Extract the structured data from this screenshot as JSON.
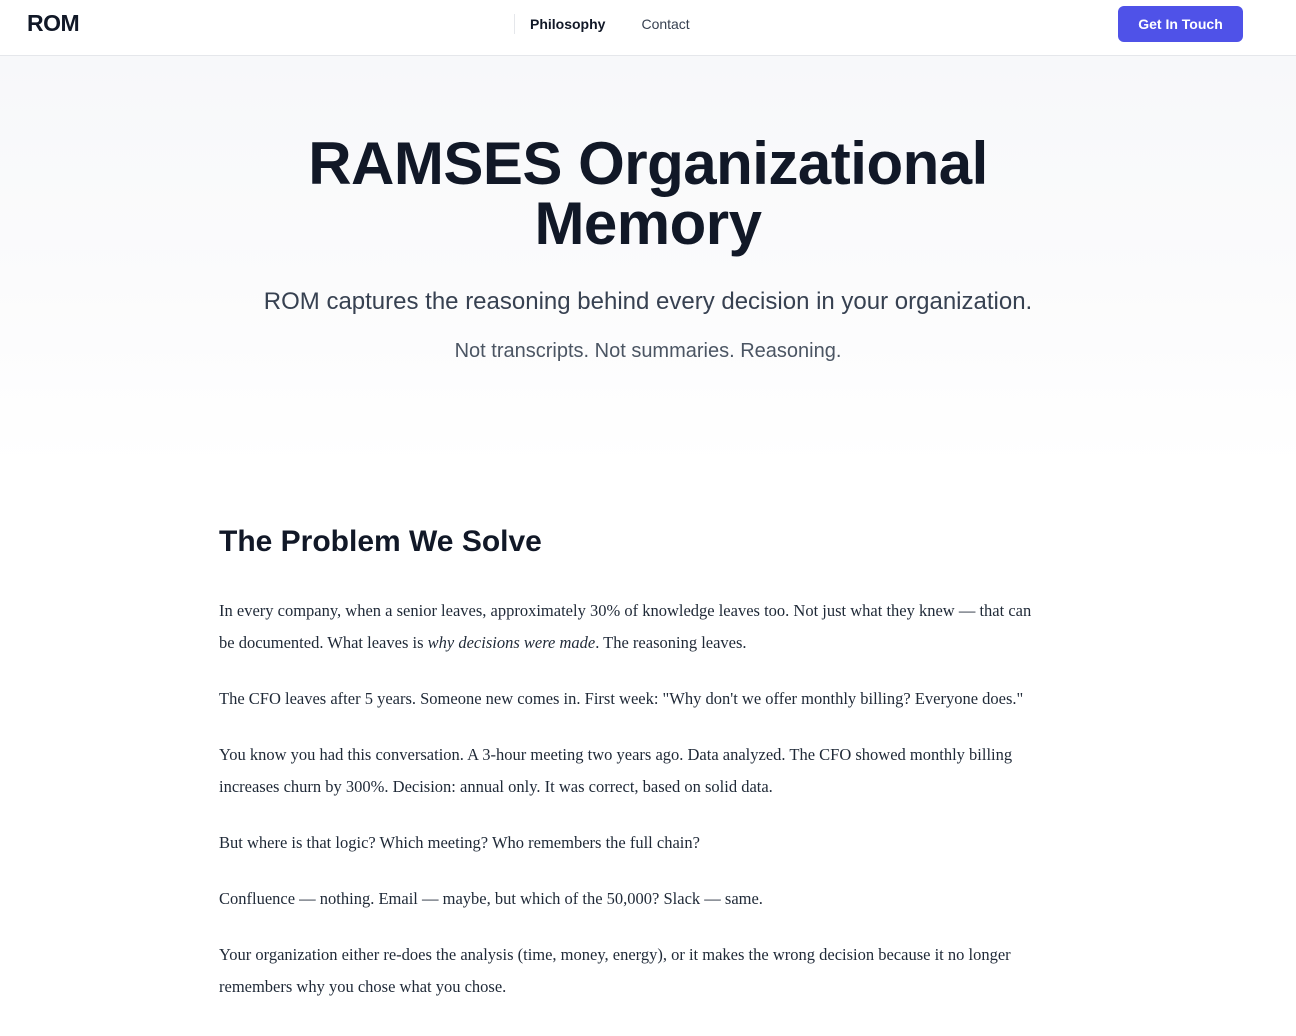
{
  "header": {
    "brand": "ROM",
    "nav": [
      {
        "label": "Philosophy"
      },
      {
        "label": "Contact"
      }
    ],
    "cta_label": "Get In Touch"
  },
  "hero": {
    "title": "RAMSES Organizational Memory",
    "subtitle": "ROM captures the reasoning behind every decision in your organization.",
    "tagline": "Not transcripts. Not summaries. Reasoning."
  },
  "problem": {
    "heading": "The Problem We Solve",
    "p1_before": "In every company, when a senior leaves, approximately 30% of knowledge leaves too. Not just what they knew — that can be documented. What leaves is ",
    "p1_emphasis": "why decisions were made",
    "p1_after": ". The reasoning leaves.",
    "paragraphs": [
      "The CFO leaves after 5 years. Someone new comes in. First week: \"Why don't we offer monthly billing? Everyone does.\"",
      "You know you had this conversation. A 3-hour meeting two years ago. Data analyzed. The CFO showed monthly billing increases churn by 300%. Decision: annual only. It was correct, based on solid data.",
      "But where is that logic? Which meeting? Who remembers the full chain?",
      "Confluence — nothing. Email — maybe, but which of the 50,000? Slack — same.",
      "Your organization either re-does the analysis (time, money, energy), or it makes the wrong decision because it no longer remembers why you chose what you chose."
    ]
  }
}
